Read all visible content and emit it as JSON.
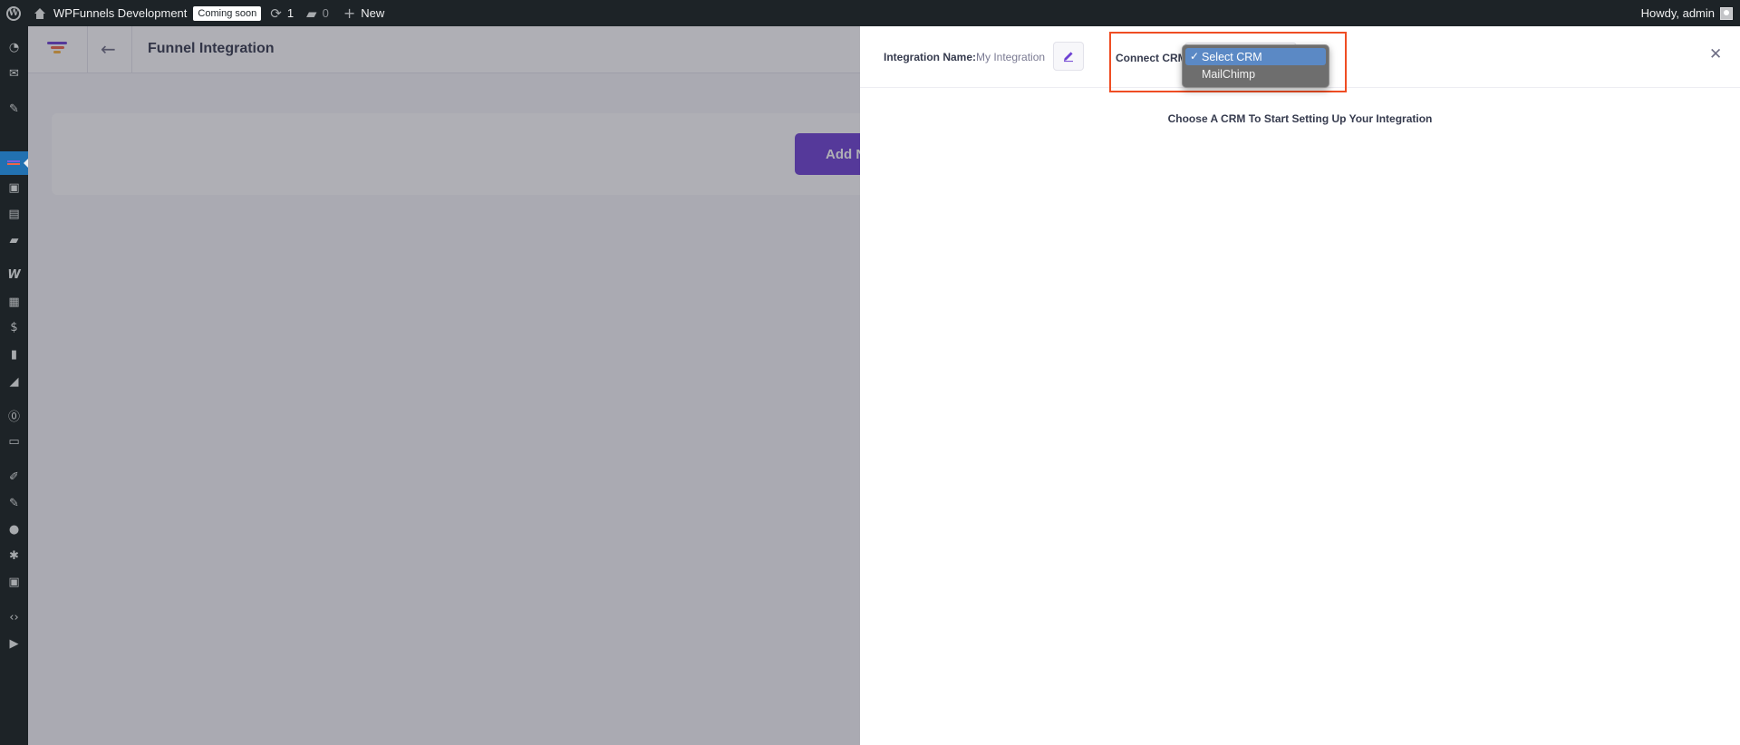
{
  "admin_bar": {
    "site_name": "WPFunnels Development",
    "coming_soon": "Coming soon",
    "updates_count": "1",
    "comments_count": "0",
    "new_label": "New",
    "greeting": "Howdy, admin"
  },
  "admin_menu": {
    "icons": [
      "dashboard-icon",
      "mail-icon",
      "pin-icon",
      "wpfunnels-icon",
      "media-icon",
      "pages-icon",
      "comments-icon",
      "woocommerce-icon",
      "products-icon",
      "payments-icon",
      "analytics-icon",
      "marketing-icon",
      "elementor-icon",
      "templates-icon",
      "appearance-icon",
      "plugins-icon",
      "users-icon",
      "tools-icon",
      "settings-icon",
      "code-icon",
      "play-icon"
    ]
  },
  "plugin_header": {
    "title": "Funnel Integration"
  },
  "main": {
    "add_button_label": "Add N"
  },
  "drawer": {
    "integration_name_label": "Integration Name:",
    "integration_name_value": "My Integration",
    "connect_crm_label": "Connect CRM",
    "empty_message": "Choose A CRM To Start Setting Up Your Integration"
  },
  "crm_dropdown": {
    "selected": "Select CRM",
    "options": [
      "Select CRM",
      "MailChimp"
    ]
  },
  "colors": {
    "brand_purple": "#6e42d3",
    "highlight_red": "#ef4d23",
    "selected_option": "#5b89c5"
  }
}
